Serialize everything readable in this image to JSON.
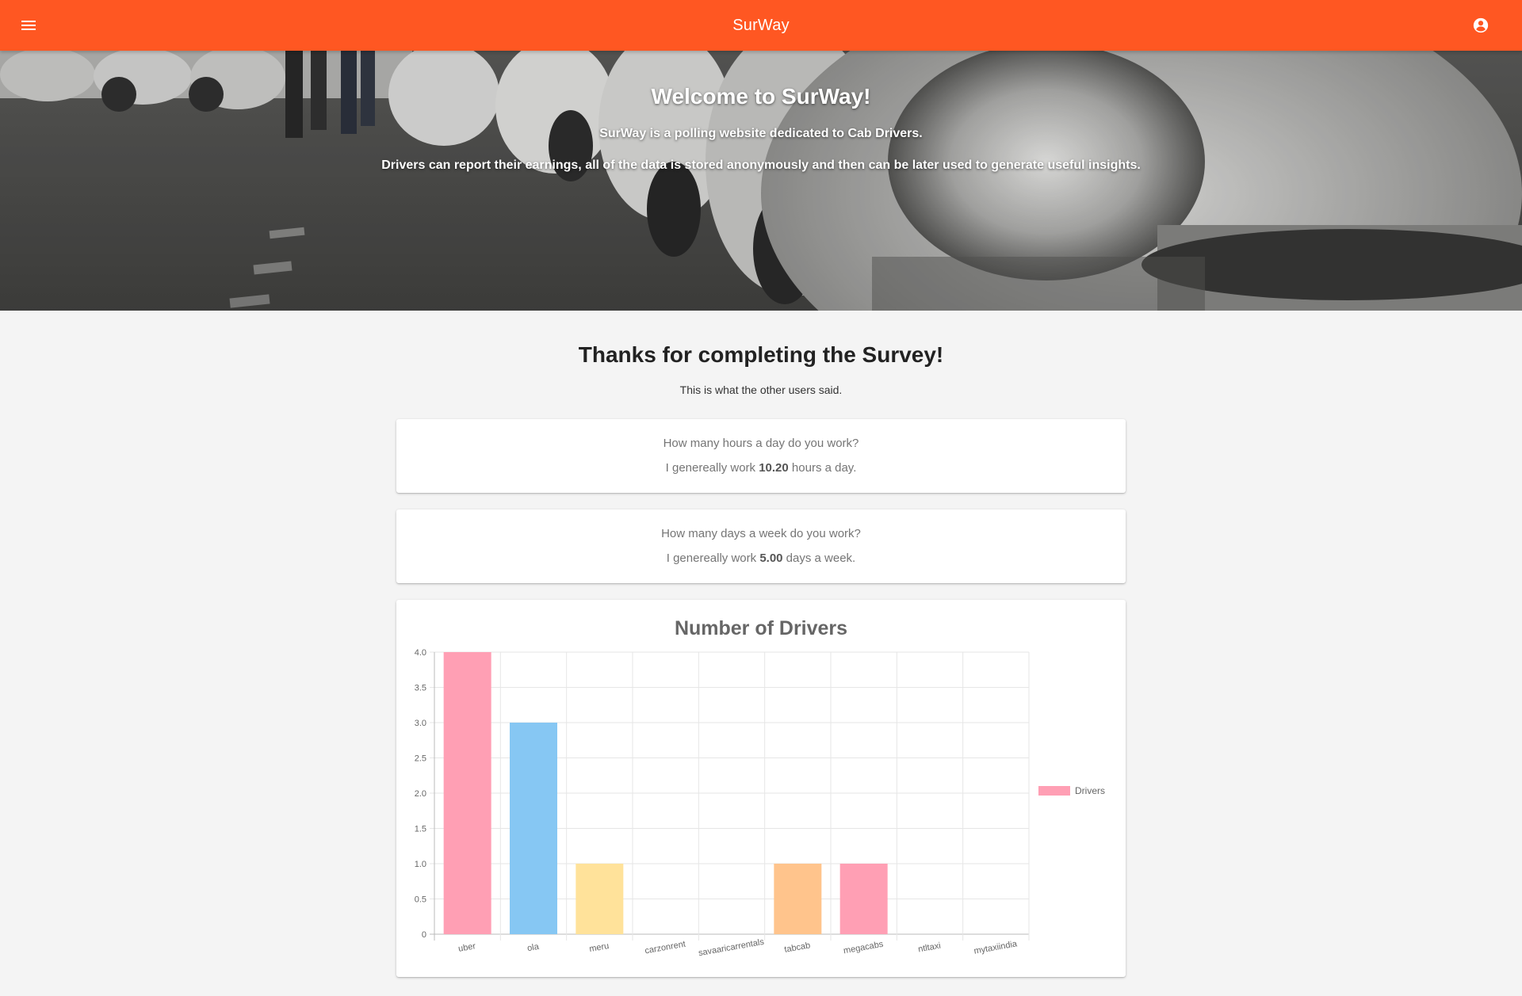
{
  "appbar": {
    "title": "SurWay",
    "accent": "#ff5722"
  },
  "icons": {
    "menu": "menu-icon",
    "account": "account-circle-icon"
  },
  "hero": {
    "title": "Welcome to SurWay!",
    "line1": "SurWay is a polling website dedicated to Cab Drivers.",
    "line2": "Drivers can report their earnings, all of the data is stored anonymously and then can be later used to generate useful insights."
  },
  "main": {
    "heading": "Thanks for completing the Survey!",
    "subtitle": "This is what the other users said."
  },
  "cards": {
    "hours": {
      "question": "How many hours a day do you work?",
      "prefix": "I genereally work ",
      "value": "10.20",
      "suffix": " hours a day."
    },
    "days": {
      "question": "How many days a week do you work?",
      "prefix": "I genereally work ",
      "value": "5.00",
      "suffix": " days a week."
    }
  },
  "chart_data": {
    "type": "bar",
    "title": "Number of Drivers",
    "categories": [
      "uber",
      "ola",
      "meru",
      "carzonrent",
      "savaaricarrentals",
      "tabcab",
      "megacabs",
      "ntltaxi",
      "mytaxiindia"
    ],
    "series": [
      {
        "name": "Drivers",
        "values": [
          4,
          3,
          1,
          0,
          0,
          1,
          1,
          0,
          0
        ]
      }
    ],
    "bar_colors": [
      "#ff9fb4",
      "#86c7f3",
      "#ffe29a",
      "#a5dfdf",
      "#ccb2ff",
      "#ffc48c",
      "#ff9fb4",
      "#86c7f3",
      "#ffe29a"
    ],
    "ylim": [
      0,
      4
    ],
    "yticks": [
      "0",
      "0.5",
      "1.0",
      "1.5",
      "2.0",
      "2.5",
      "3.0",
      "3.5",
      "4.0"
    ],
    "grid": true,
    "legend_position": "right",
    "xlabel": "",
    "ylabel": ""
  }
}
